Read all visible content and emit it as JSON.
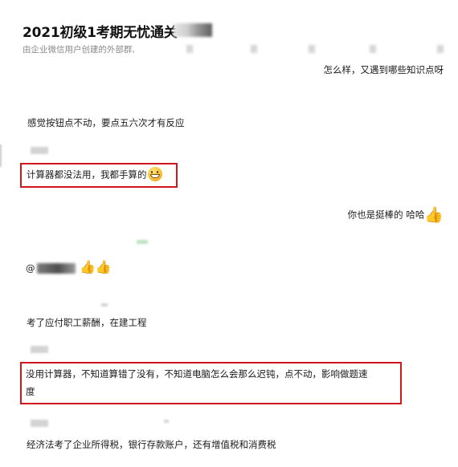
{
  "header": {
    "title": "2021初级1考期无忧通关",
    "subtitle": "由企业微信用户创建的外部群,"
  },
  "messages": [
    {
      "side": "right",
      "text": "怎么样，又遇到哪些知识点呀"
    },
    {
      "side": "left",
      "text": "感觉按钮点不动，要点五六次才有反应"
    },
    {
      "side": "left",
      "text": "计算器都没法用，我都手算的",
      "highlighted": true,
      "emoji": "grinning-face"
    },
    {
      "side": "right",
      "text": "你也是挺棒的 哈哈",
      "emoji": "thumbs-up"
    },
    {
      "side": "left",
      "text": "@",
      "emoji": "thumbs-up"
    },
    {
      "side": "left",
      "text": "考了应付职工薪酬，在建工程"
    },
    {
      "side": "left",
      "line1": "没用计算器，不知道算错了没有，不知道电脑怎么会那么迟钝，点不动，影响做题速",
      "line2": "度",
      "highlighted": true
    },
    {
      "side": "left",
      "text": "经济法考了企业所得税，银行存款账户，还有增值税和消费税"
    }
  ],
  "icons": {
    "grin": "grinning-face-emoji",
    "thumb": "thumbs-up-emoji"
  },
  "colors": {
    "highlight_border": "#d0161d",
    "emoji_yellow": "#f7c23b",
    "subtitle_gray": "#8a8a8a"
  }
}
